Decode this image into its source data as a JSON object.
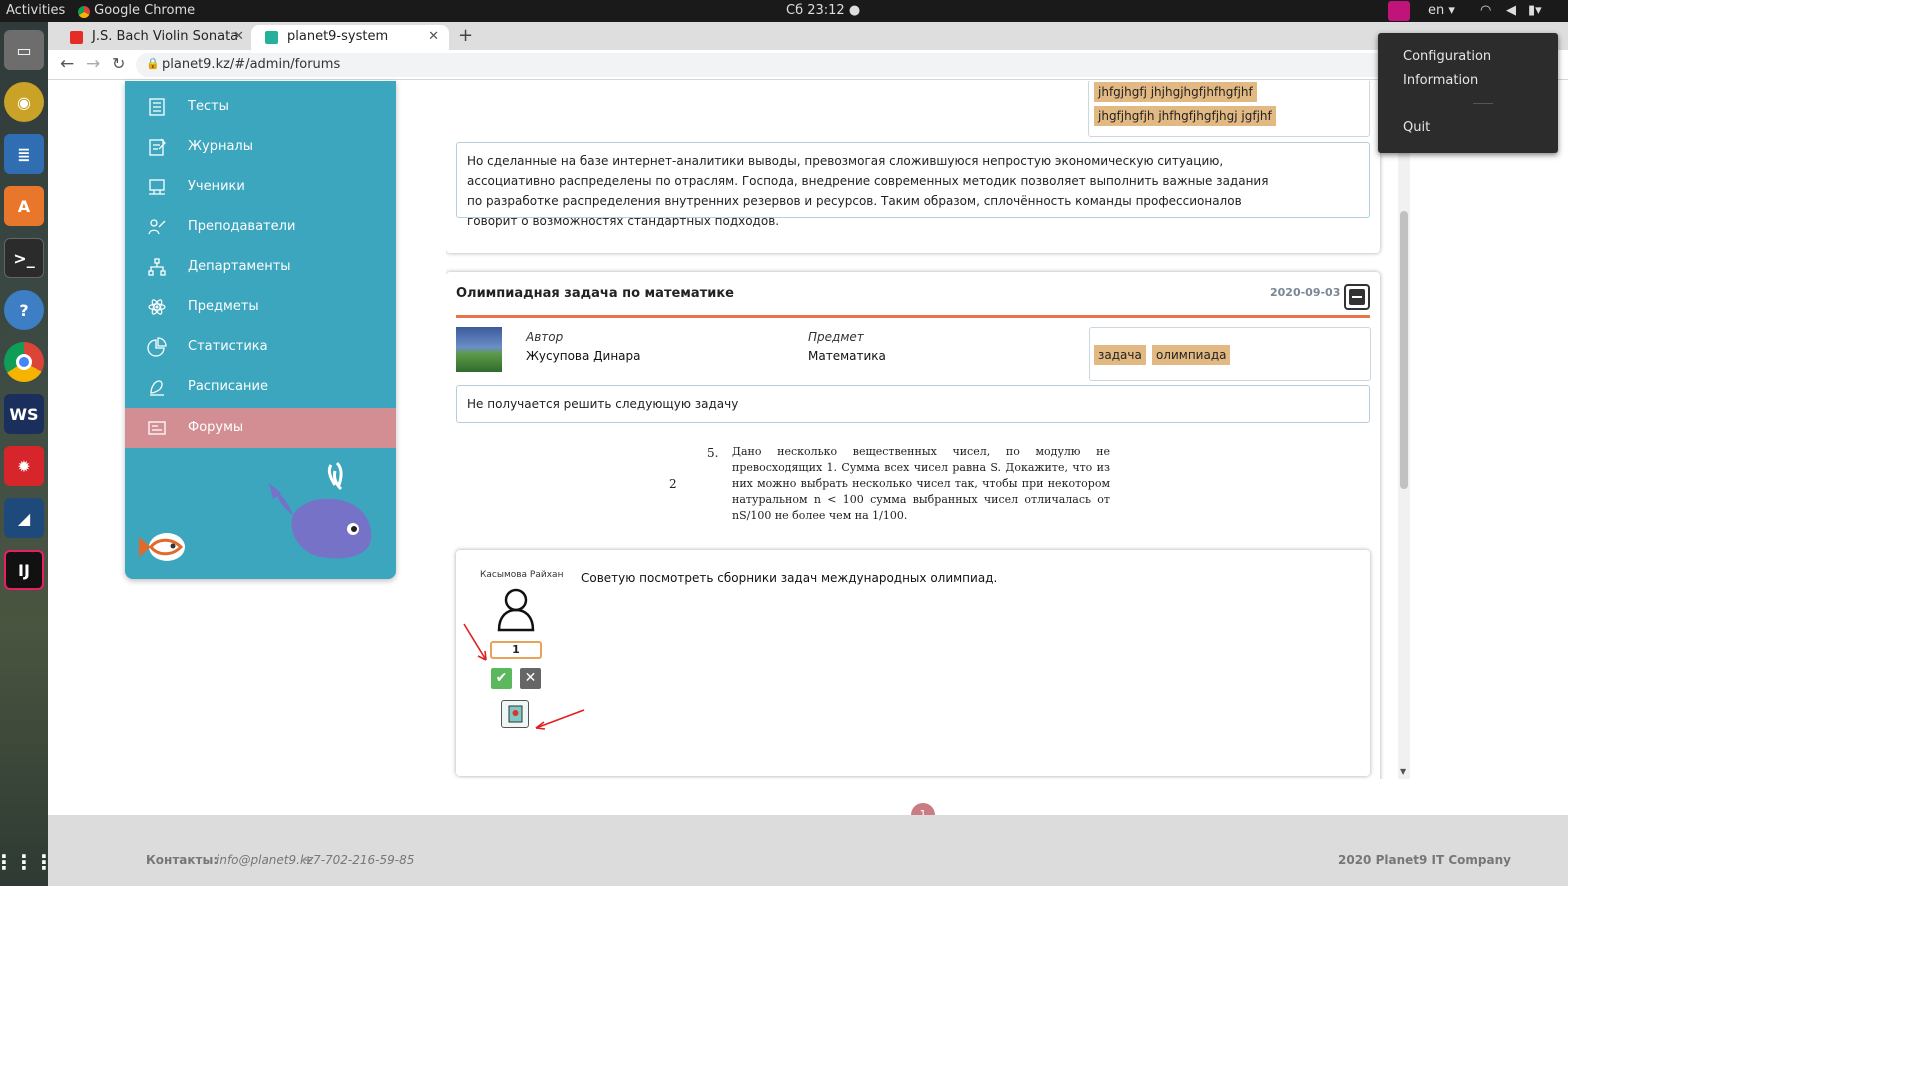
{
  "system_bar": {
    "activities": "Activities",
    "app": "Google Chrome",
    "clock": "Сб 23:12 ●",
    "lang": "en ▾"
  },
  "tabs": [
    {
      "label": "J.S. Bach Violin Sonata",
      "fav_color": "#e52d27"
    },
    {
      "label": "planet9-system",
      "fav_color": "#25b09c"
    }
  ],
  "new_tab": "+",
  "url": "planet9.kz/#/admin/forums",
  "sidebar": {
    "items": [
      {
        "label": "Тесты",
        "icon": "test-list-icon"
      },
      {
        "label": "Журналы",
        "icon": "journal-icon"
      },
      {
        "label": "Ученики",
        "icon": "students-icon"
      },
      {
        "label": "Преподаватели",
        "icon": "teachers-icon"
      },
      {
        "label": "Департаменты",
        "icon": "departments-icon"
      },
      {
        "label": "Предметы",
        "icon": "atom-icon"
      },
      {
        "label": "Статистика",
        "icon": "pie-chart-icon"
      },
      {
        "label": "Расписание",
        "icon": "schedule-icon"
      },
      {
        "label": "Форумы",
        "icon": "forum-icon",
        "active": true
      }
    ]
  },
  "post1": {
    "tags": [
      "jhfgjhgfj jhjhgjhgfjhfhgfjhf",
      "jhgfjhgfjh jhfhgfjhgfjhgj jgfjhf"
    ],
    "body": "Но сделанные на базе интернет-аналитики выводы, превозмогая сложившуюся непростую экономическую ситуацию, ассоциативно распределены по отраслям. Господа, внедрение современных методик позволяет выполнить важные задания по разработке распределения внутренних резервов и ресурсов. Таким образом, сплочённость команды профессионалов говорит о возможностях стандартных подходов."
  },
  "post2": {
    "title": "Олимпиадная задача по математике",
    "date": "2020-09-03",
    "author_label": "Автор",
    "author": "Жусупова Динара",
    "subject_label": "Предмет",
    "subject": "Математика",
    "tags": [
      "задача",
      "олимпиада"
    ],
    "body": "Не получается решить следующую задачу",
    "problem_left_number": "2",
    "problem_number": "5.",
    "problem_text": "Дано несколько вещественных чисел, по модулю не превосходящих 1. Сумма всех чисел равна S. Докажите, что из них можно выбрать несколько чисел так, чтобы при некотором натуральном n < 100 сумма выбранных чисел отличалась от nS/100 не более чем на 1/100."
  },
  "comment": {
    "author": "Касымова Райхан",
    "text": "Советую посмотреть сборники задач международных олимпиад.",
    "score": "1"
  },
  "pager": "1",
  "footer": {
    "contacts_label": "Контакты:",
    "email": "info@planet9.kz",
    "phone": "+7-702-216-59-85",
    "copyright": "2020 Planet9 IT Company"
  },
  "dropdown": {
    "items": [
      "Configuration",
      "Information",
      "Quit"
    ]
  },
  "colors": {
    "accent": "#3ba6bd",
    "active": "#d28e93",
    "tag": "#e3b983",
    "divider": "#e8734c"
  }
}
